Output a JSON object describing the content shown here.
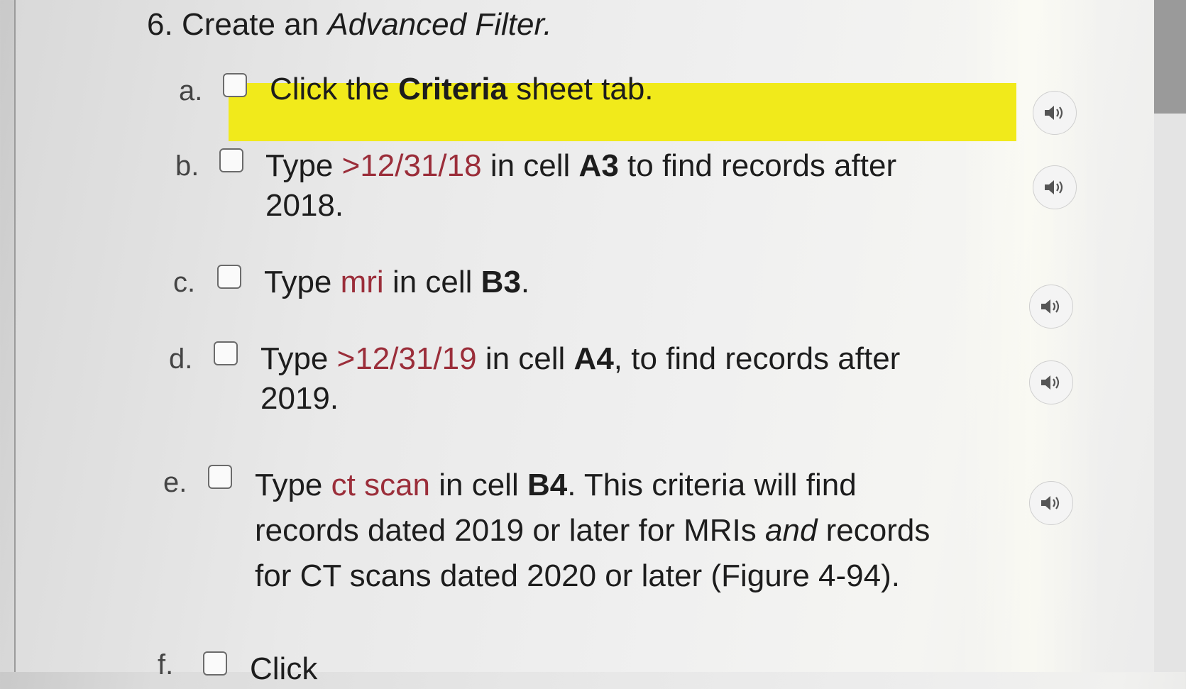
{
  "heading": {
    "number": "6.",
    "text_plain": "Create an ",
    "text_italic": "Advanced Filter."
  },
  "steps": [
    {
      "letter": "a.",
      "parts": [
        "Click the ",
        "Criteria",
        " sheet tab."
      ]
    },
    {
      "letter": "b.",
      "parts": [
        "Type ",
        ">12/31/18",
        " in cell ",
        "A3",
        " to find records after"
      ],
      "line2": "2018."
    },
    {
      "letter": "c.",
      "parts": [
        "Type ",
        "mri",
        " in cell ",
        "B3",
        "."
      ]
    },
    {
      "letter": "d.",
      "parts": [
        "Type ",
        ">12/31/19",
        " in cell ",
        "A4",
        ", to find records after"
      ],
      "line2": "2019."
    },
    {
      "letter": "e.",
      "parts": [
        "Type ",
        "ct scan",
        " in cell ",
        "B4",
        ". This criteria will find"
      ],
      "line2_parts": [
        "records dated 2019 or later for MRIs ",
        "and",
        " records"
      ],
      "line3": "for CT scans dated 2020 or later (Figure 4-94)."
    },
    {
      "letter": "f.",
      "text": "Click"
    }
  ],
  "colors": {
    "highlight": "#f1ea1b",
    "entry_text": "#9b2e3a"
  },
  "icons": {
    "audio": "speaker-icon",
    "checkbox": "checkbox-icon"
  }
}
